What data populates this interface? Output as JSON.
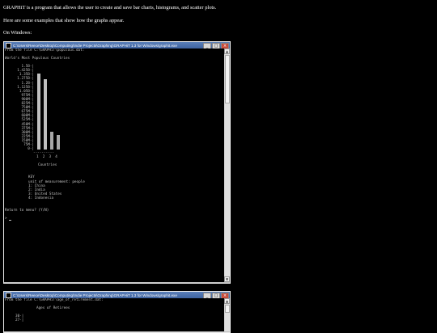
{
  "intro": {
    "line1": "GRAPHiT is a program that allows the user to create and save bar charts, histograms, and scatter plots.",
    "line2": "Here are some examples that show how the graphs appear.",
    "line3": "On Windows:"
  },
  "window1": {
    "title": "C:\\Users\\Reece\\Desktop\\Computing\\Indie Projects\\Graphing\\GRAPHiT 1.3 for Windows\\graphit.exe",
    "minimize": "_",
    "maximize": "□",
    "close": "×",
    "file_line": "From the file C:\\GRAPHiT\\populous.dat:",
    "chart_title": "World's Most Populous Countries",
    "y_ticks": [
      "1.5B-|",
      "1.425B-|",
      "1.35B-|",
      "1.275B-|",
      "1.2B-|",
      "1.125B-|",
      "1.05B-|",
      "975M-|",
      "900M-|",
      "825M-|",
      "750M-|",
      "675M-|",
      "600M-|",
      "525M-|",
      "450M-|",
      "375M-|",
      "300M-|",
      "225M-|",
      "150M-|",
      "75M-|",
      "0-|"
    ],
    "x_axis_line": "----------",
    "x_ticks": "1  2  3  4",
    "x_label": "Countries",
    "key_title": "KEY",
    "unit_line": "unit of measurement: people",
    "key_items": [
      "1: China",
      "2: India",
      "3: United States",
      "4: Indonesia"
    ],
    "prompt_line": "Return to menu? (Y/N)",
    "input_prompt": ">"
  },
  "window2": {
    "title": "C:\\Users\\Reece\\Desktop\\Computing\\Indie Projects\\Graphing\\GRAPHiT 1.3 for Windows\\graphit.exe",
    "minimize": "_",
    "maximize": "□",
    "close": "×",
    "file_line": "From the file C:\\GRAPHiT\\age_of_retirement.dat:",
    "chart_title": "Ages of Retirees",
    "y_ticks": [
      "30-|",
      "27-|"
    ]
  },
  "chart_data": {
    "type": "bar",
    "title": "World's Most Populous Countries",
    "xlabel": "Countries",
    "ylabel": "",
    "categories": [
      "1",
      "2",
      "3",
      "4"
    ],
    "values": [
      1380000000,
      1280000000,
      320000000,
      260000000
    ],
    "ylim": [
      0,
      1500000000
    ]
  },
  "scrollbar": {
    "up": "▲",
    "down": "▼"
  }
}
